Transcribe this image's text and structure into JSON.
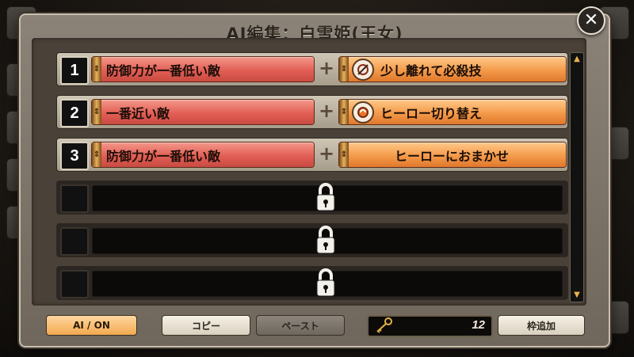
{
  "dialog": {
    "title": "AI編集：白雪姫(王女)",
    "close_icon": "close-icon"
  },
  "ai_rows": [
    {
      "index": "1",
      "target": "防御力が一番低い敵",
      "action": "少し離れて必殺技",
      "action_icon": "sword-swirl-icon"
    },
    {
      "index": "2",
      "target": "一番近い敵",
      "action": "ヒーロー切り替え",
      "action_icon": "swap-icon"
    },
    {
      "index": "3",
      "target": "防御力が一番低い敵",
      "action": "ヒーローにおまかせ",
      "action_icon": ""
    }
  ],
  "locked_rows": [
    {
      "lock_icon": "lock-icon"
    },
    {
      "lock_icon": "lock-icon"
    },
    {
      "lock_icon": "lock-icon"
    }
  ],
  "plus_symbol": "+",
  "footer": {
    "ai_toggle": "AI / ON",
    "copy": "コピー",
    "paste": "ペースト",
    "key_count": "12",
    "add_slot": "枠追加"
  },
  "colors": {
    "target_slot": "#e25f55",
    "action_slot": "#f39a4a",
    "ai_on_button": "#f2a94f"
  }
}
